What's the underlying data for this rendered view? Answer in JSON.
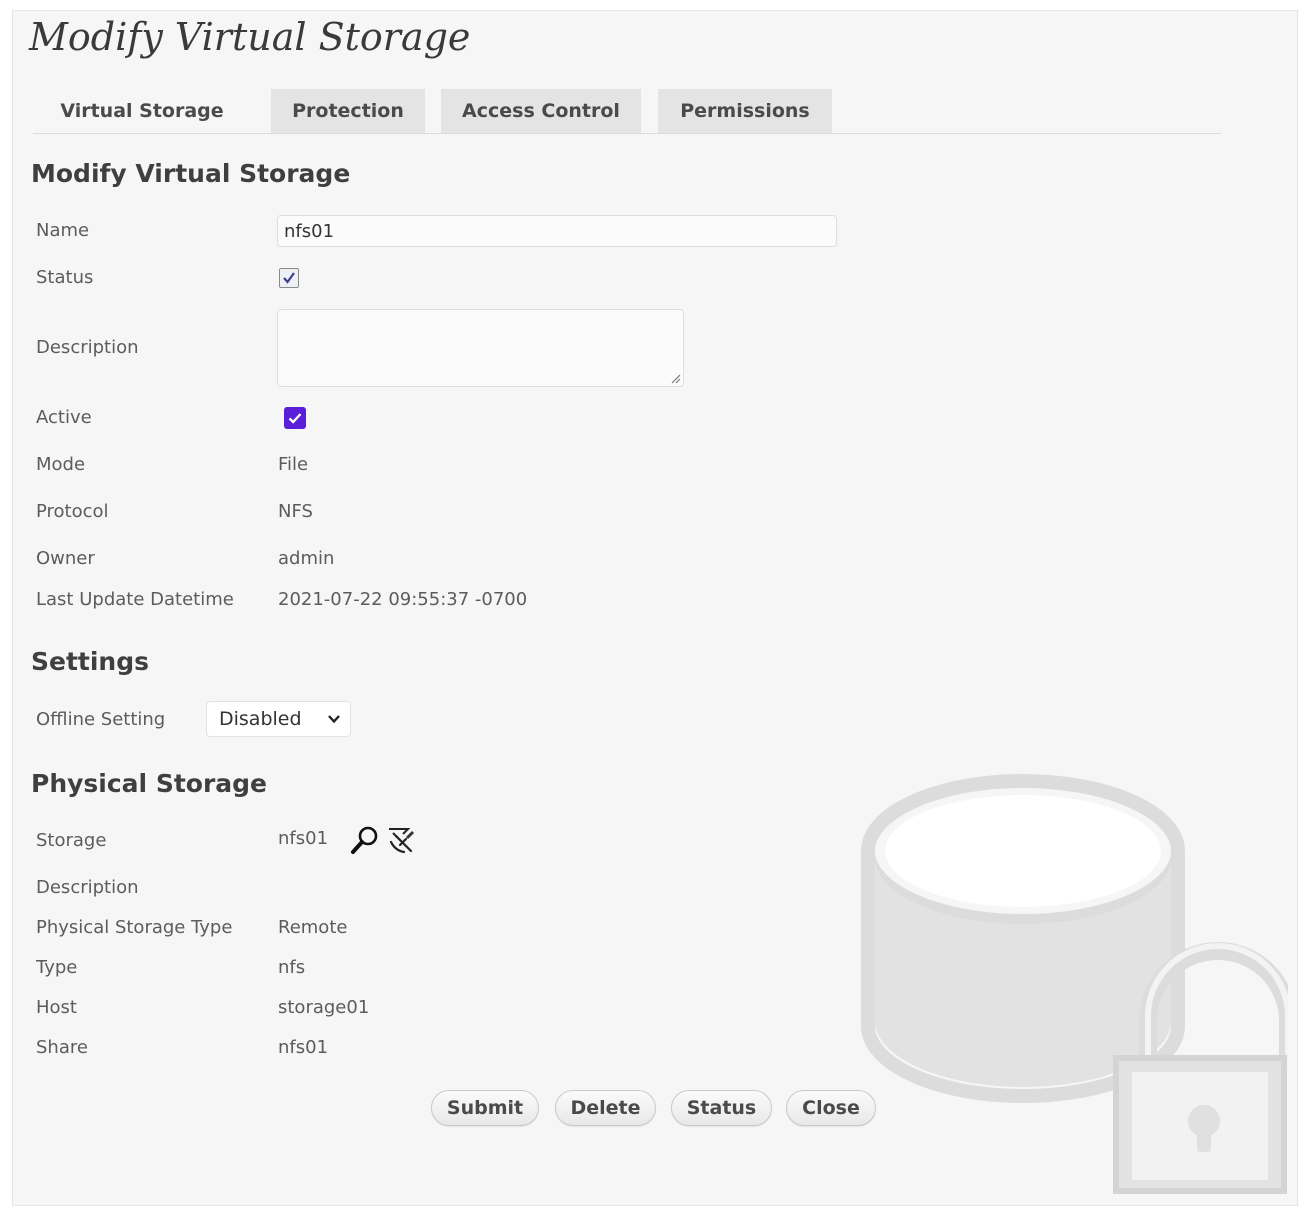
{
  "page": {
    "title": "Modify Virtual Storage"
  },
  "tabs": [
    {
      "label": "Virtual Storage",
      "active": true
    },
    {
      "label": "Protection",
      "active": false
    },
    {
      "label": "Access Control",
      "active": false
    },
    {
      "label": "Permissions",
      "active": false
    }
  ],
  "virtual_storage": {
    "heading": "Modify Virtual Storage",
    "name_label": "Name",
    "name_value": "nfs01",
    "status_label": "Status",
    "status_checked": true,
    "description_label": "Description",
    "description_value": "",
    "active_label": "Active",
    "active_checked": true,
    "mode_label": "Mode",
    "mode_value": "File",
    "protocol_label": "Protocol",
    "protocol_value": "NFS",
    "owner_label": "Owner",
    "owner_value": "admin",
    "last_update_label": "Last Update Datetime",
    "last_update_value": "2021-07-22 09:55:37 -0700"
  },
  "settings": {
    "heading": "Settings",
    "offline_label": "Offline Setting",
    "offline_value": "Disabled"
  },
  "physical_storage": {
    "heading": "Physical Storage",
    "storage_label": "Storage",
    "storage_value": "nfs01",
    "storage_icons": [
      "search-icon",
      "edit-icon"
    ],
    "description_label": "Description",
    "description_value": "",
    "type_label_full": "Physical Storage Type",
    "type_value_full": "Remote",
    "type_label": "Type",
    "type_value": "nfs",
    "host_label": "Host",
    "host_value": "storage01",
    "share_label": "Share",
    "share_value": "nfs01"
  },
  "buttons": {
    "submit": "Submit",
    "delete": "Delete",
    "status": "Status",
    "close": "Close"
  },
  "colors": {
    "panel_bg": "#f6f6f6",
    "tab_bg": "#e4e4e4",
    "checkbox_accent": "#5a1fd6",
    "illustration": "#dedede"
  }
}
